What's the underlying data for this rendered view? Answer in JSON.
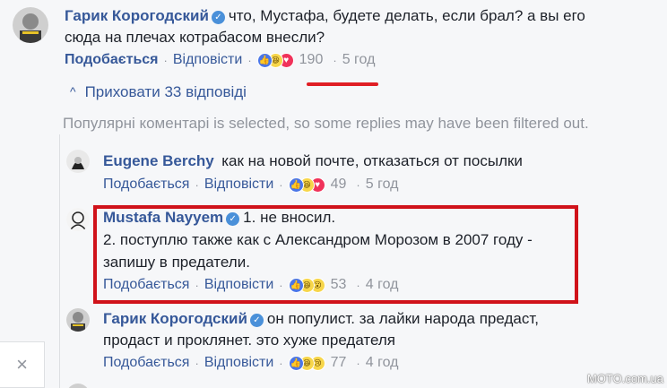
{
  "comments": [
    {
      "author": "Гарик Корогодский",
      "verified": true,
      "lines": [
        "что, Мустафа, будете делать, если брал? а вы его",
        "сюда на плечах котрабасом внесли?"
      ],
      "like_label": "Подобається",
      "reply_label": "Відповісти",
      "reactions": [
        "like",
        "haha",
        "love"
      ],
      "count": "190",
      "time": "5 год"
    },
    {
      "author": "Eugene Berchy",
      "verified": false,
      "lines": [
        "как на новой почте, отказаться от посылки"
      ],
      "like_label": "Подобається",
      "reply_label": "Відповісти",
      "reactions": [
        "like",
        "haha",
        "love"
      ],
      "count": "49",
      "time": "5 год"
    },
    {
      "author": "Mustafa Nayyem",
      "verified": true,
      "lines": [
        "1. не вносил.",
        "2. поступлю также как с Александром Морозом в 2007 году -",
        "запишу в предатели."
      ],
      "like_label": "Подобається",
      "reply_label": "Відповісти",
      "reactions": [
        "like",
        "haha",
        "wow"
      ],
      "count": "53",
      "time": "4 год"
    },
    {
      "author": "Гарик Корогодский",
      "verified": true,
      "lines": [
        "он популист. за лайки народа предаст,",
        "продаст и проклянет. это хуже предателя"
      ],
      "like_label": "Подобається",
      "reply_label": "Відповісти",
      "reactions": [
        "like",
        "haha",
        "sad"
      ],
      "count": "77",
      "time": "4 год"
    }
  ],
  "hide_replies_label": "Приховати 33 відповіді",
  "filter_notice": "Популярні коментарі is selected, so some replies may have been filtered out.",
  "close_label": "×",
  "watermark": "MOTO.com.ua",
  "icons": {
    "verified": "✓",
    "chevron": "^",
    "like": "👍",
    "haha": "😆",
    "love": "♥",
    "wow": "😮",
    "sad": "😢"
  }
}
